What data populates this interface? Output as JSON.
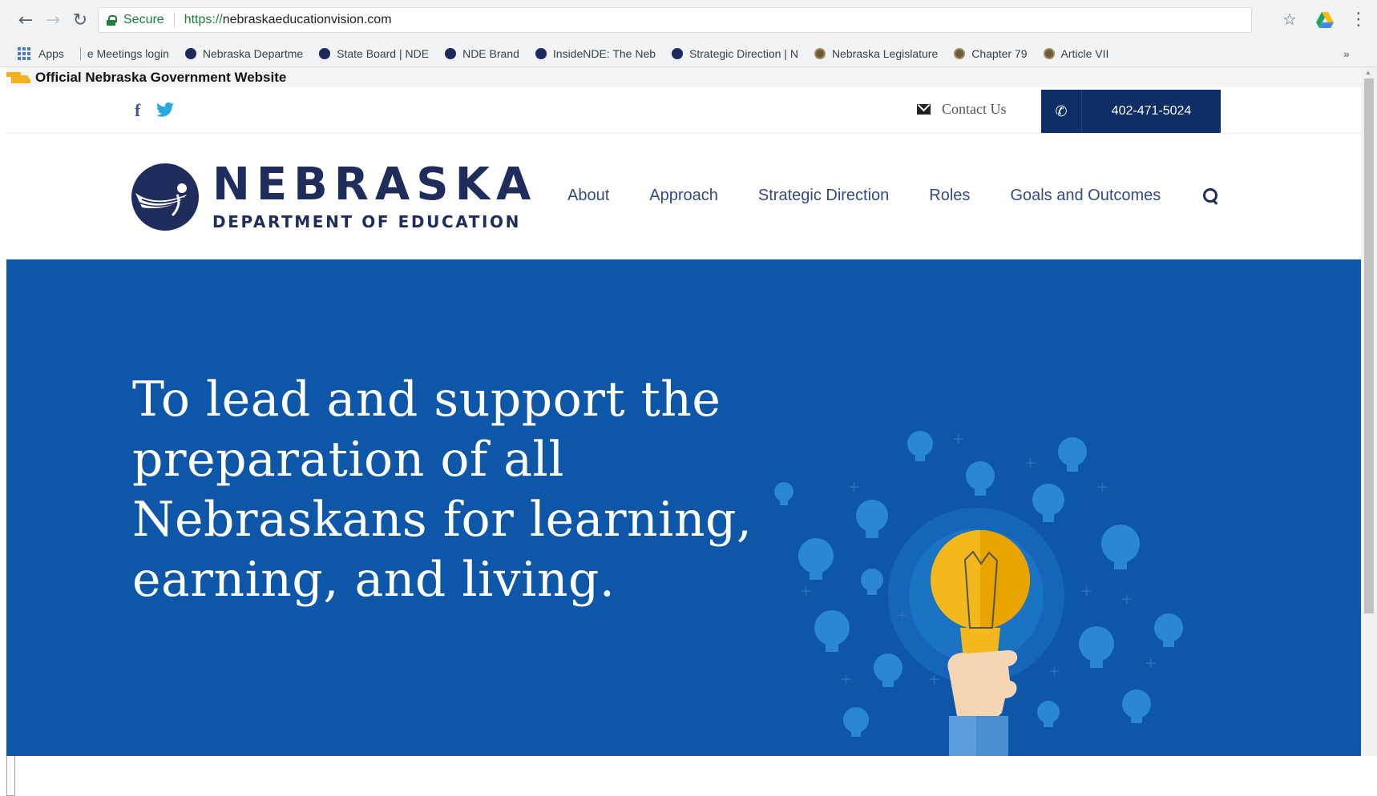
{
  "browser": {
    "secure_label": "Secure",
    "url_scheme": "https://",
    "url_host": "nebraskaeducationvision.com",
    "bookmarks": {
      "apps": "Apps",
      "items": [
        "e Meetings login",
        "Nebraska Departme",
        "State Board | NDE",
        "NDE Brand",
        "InsideNDE: The Neb",
        "Strategic Direction | N",
        "Nebraska Legislature",
        "Chapter 79",
        "Article VII"
      ],
      "more": "»"
    }
  },
  "banner": {
    "text": "Official Nebraska Government Website"
  },
  "topbar": {
    "contact_label": "Contact Us",
    "phone": "402-471-5024"
  },
  "logo": {
    "title": "NEBRASKA",
    "subtitle": "DEPARTMENT OF EDUCATION"
  },
  "nav": {
    "items": [
      "About",
      "Approach",
      "Strategic Direction",
      "Roles",
      "Goals and Outcomes"
    ]
  },
  "hero": {
    "headline": "To lead and support the preparation of all Nebraskans for learning, earning, and living."
  },
  "colors": {
    "hero_bg": "#0e57a8",
    "brand_navy": "#1f2d5c",
    "phone_bg": "#0e2e66",
    "nav_text": "#344a80",
    "bulb_yellow": "#f2b81e"
  }
}
